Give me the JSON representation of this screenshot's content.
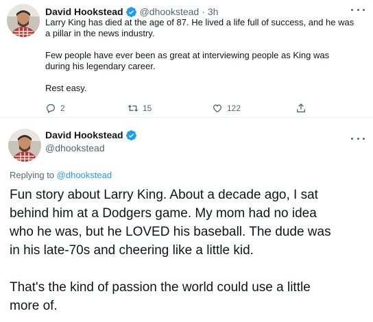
{
  "colors": {
    "text": "#0f1419",
    "secondary": "#536471",
    "accent": "#1d9bf0",
    "divider": "#eff3f4"
  },
  "tweet1": {
    "author": {
      "display_name": "David Hookstead",
      "handle": "@dhookstead",
      "separator": "·",
      "time": "3h",
      "verified_icon": "verified-badge-icon",
      "avatar": "avatar"
    },
    "text": {
      "line1": "Larry King has died at the age of 87. He lived a life full of success, and he was",
      "line2": "a pillar in the news industry.",
      "line3": "Few people have ever been as great at interviewing people as King was",
      "line4": "during his legendary career.",
      "line5": "Rest easy."
    },
    "actions": {
      "reply": {
        "icon": "reply-icon",
        "count": "2"
      },
      "retweet": {
        "icon": "retweet-icon",
        "count": "15"
      },
      "like": {
        "icon": "heart-icon",
        "count": "122"
      },
      "share": {
        "icon": "share-icon"
      }
    },
    "more_icon": "more-icon"
  },
  "tweet2": {
    "author": {
      "display_name": "David Hookstead",
      "handle": "@dhookstead",
      "verified_icon": "verified-badge-icon",
      "avatar": "avatar"
    },
    "reply_to_prefix": "Replying to",
    "reply_to_handle": "@dhookstead",
    "text": {
      "line1": "Fun story about Larry King. About a decade ago, I sat",
      "line2": "behind him at a Dodgers game. My mom had no idea",
      "line3": "who he was, but he LOVED his baseball. The dude was",
      "line4": "in his late-70s and cheering like a little kid.",
      "line5": "That's the kind of passion the world could use a little",
      "line6": "more of."
    },
    "more_icon": "more-icon"
  }
}
